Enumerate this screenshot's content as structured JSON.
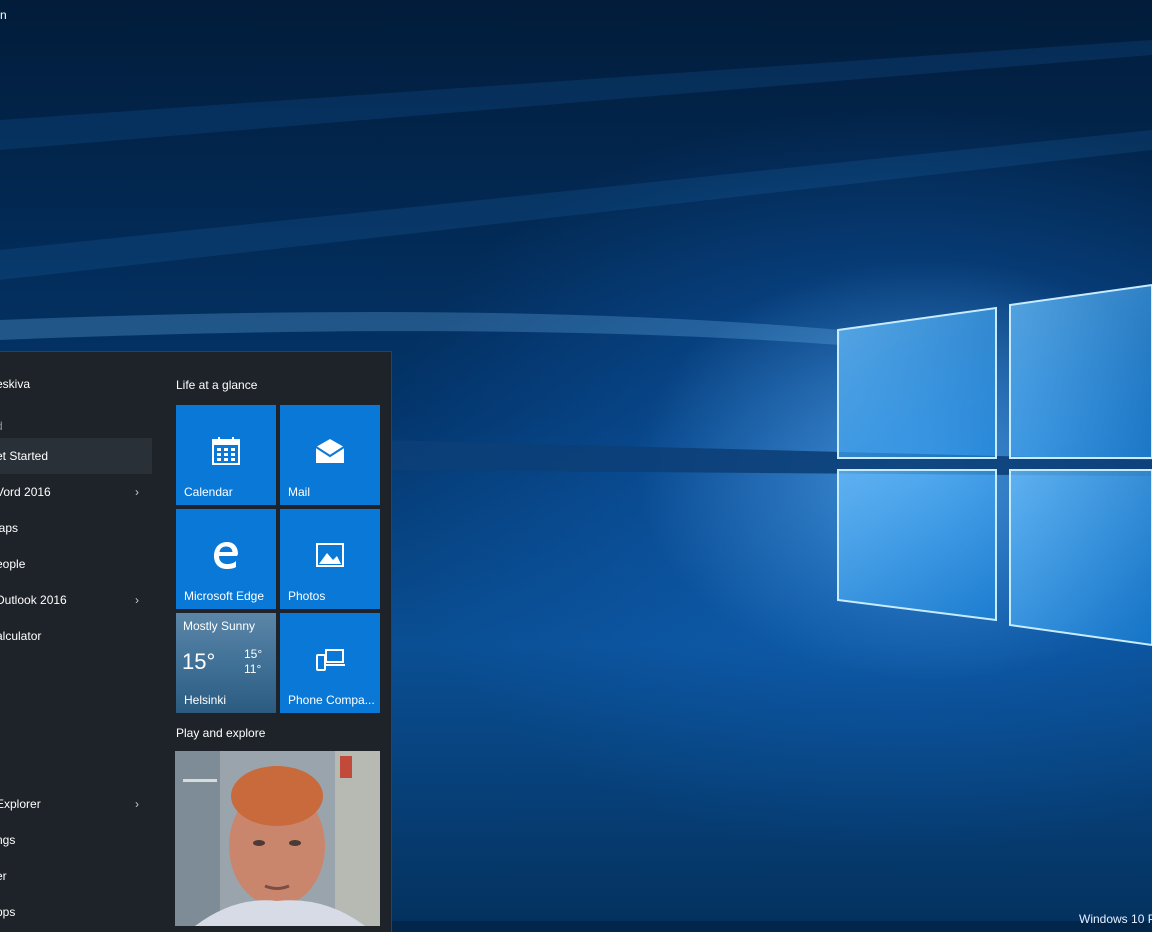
{
  "desktop": {
    "label": "n",
    "watermark": "Windows 10 P"
  },
  "start_menu": {
    "user_name": "eskiva",
    "section_letter": "d",
    "apps": [
      {
        "label": "et Started",
        "has_chevron": false
      },
      {
        "label": "Vord 2016",
        "has_chevron": true
      },
      {
        "label": "laps",
        "has_chevron": false
      },
      {
        "label": "eople",
        "has_chevron": false
      },
      {
        "label": "Dutlook 2016",
        "has_chevron": true
      },
      {
        "label": "alculator",
        "has_chevron": false
      }
    ],
    "bottom_items": [
      {
        "label": "Explorer",
        "has_chevron": true
      },
      {
        "label": "ngs",
        "has_chevron": false
      },
      {
        "label": "er",
        "has_chevron": false
      },
      {
        "label": "pps",
        "has_chevron": false
      }
    ],
    "chevron": "›",
    "groups": {
      "life": "Life at a glance",
      "play": "Play and explore"
    },
    "tiles": {
      "calendar": "Calendar",
      "mail": "Mail",
      "edge": "Microsoft Edge",
      "photos": "Photos",
      "phone": "Phone Compa...",
      "weather": {
        "condition": "Mostly Sunny",
        "temp": "15°",
        "high": "15°",
        "low": "11°",
        "city": "Helsinki"
      }
    },
    "colors": {
      "tile": "#0a78d6",
      "menu_bg": "#1e2329"
    }
  }
}
